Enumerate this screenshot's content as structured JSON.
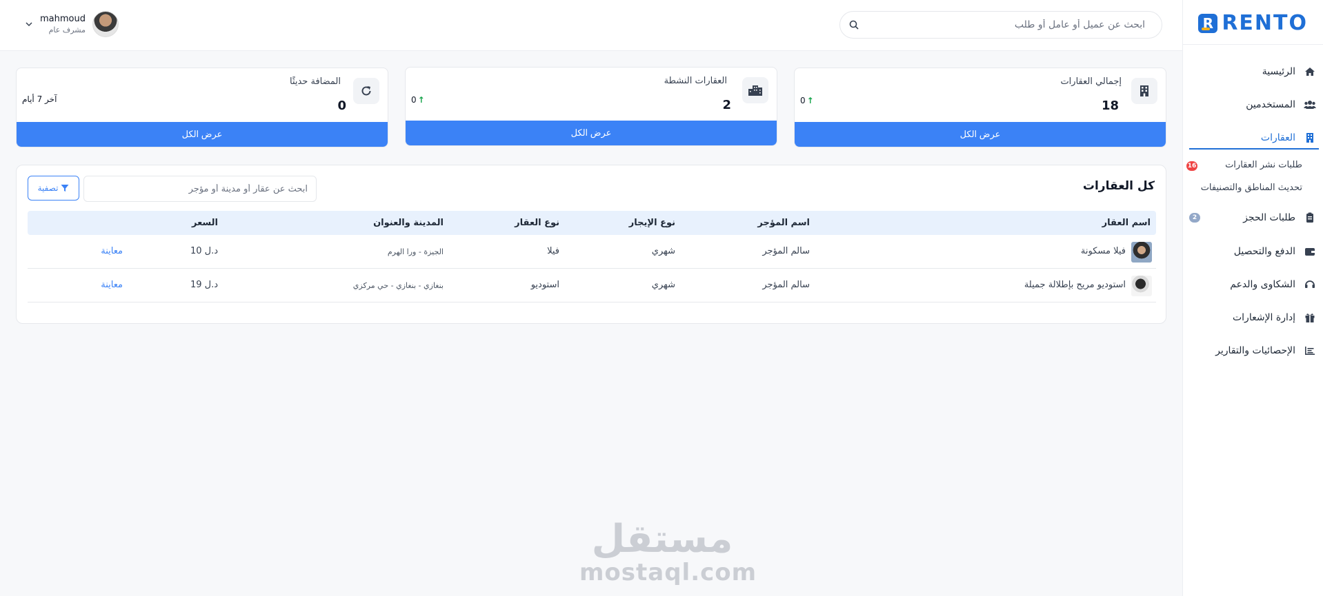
{
  "brand": {
    "name": "RENTO",
    "colors": {
      "primary": "#3b82f6",
      "accent": "#f5b21b",
      "active": "#1f6fd6"
    }
  },
  "header": {
    "search_placeholder": "ابحث عن عميل أو عامل أو طلب",
    "user": {
      "name": "mahmoud",
      "role": "مشرف عام"
    }
  },
  "sidebar": {
    "items": [
      {
        "label": "الرئيسية",
        "icon": "home-icon"
      },
      {
        "label": "المستخدمين",
        "icon": "users-icon"
      },
      {
        "label": "العقارات",
        "icon": "building-icon",
        "active": true
      },
      {
        "label": "طلبات الحجز",
        "icon": "clipboard-icon",
        "badge": "2"
      },
      {
        "label": "الدفع والتحصيل",
        "icon": "wallet-icon"
      },
      {
        "label": "الشكاوى والدعم",
        "icon": "headset-icon"
      },
      {
        "label": "إدارة الإشعارات",
        "icon": "gift-icon"
      },
      {
        "label": "الإحصائيات والتقارير",
        "icon": "chart-icon"
      }
    ],
    "sub_items": [
      {
        "label": "طلبات نشر العقارات",
        "badge": "16"
      },
      {
        "label": "تحديث المناطق والتصنيفات"
      }
    ]
  },
  "stats": [
    {
      "label": "إجمالي العقارات",
      "value": "18",
      "trend": "0",
      "button": "عرض الكل",
      "icon": "office-building-icon"
    },
    {
      "label": "العقارات النشطة",
      "value": "2",
      "trend": "0",
      "button": "عرض الكل",
      "icon": "city-icon"
    },
    {
      "label": "المضافة حديثًا",
      "value": "0",
      "note": "آخر 7 أيام",
      "button": "عرض الكل",
      "icon": "refresh-icon"
    }
  ],
  "properties": {
    "title": "كل العقارات",
    "search_placeholder": "ابحث عن عقار أو مدينة أو مؤجر",
    "filter_label": "تصفية",
    "columns": [
      "اسم العقار",
      "اسم المؤجر",
      "نوع الإيجار",
      "نوع العقار",
      "المدينة والعنوان",
      "السعر"
    ],
    "rows": [
      {
        "name": "فيلا مسكونة",
        "owner": "سالم المؤجر",
        "rent_type": "شهري",
        "type": "فيلا",
        "address": "الجيزة - ورا الهرم",
        "price": "د.ل 10",
        "action": "معاينة"
      },
      {
        "name": "استوديو مريح بإطلالة جميلة",
        "owner": "سالم المؤجر",
        "rent_type": "شهري",
        "type": "استوديو",
        "address": "بنغازي - بنغازي - حي مركزي",
        "price": "د.ل 19",
        "action": "معاينة"
      }
    ]
  },
  "watermark": {
    "arabic": "مستقل",
    "latin": "mostaql.com"
  }
}
